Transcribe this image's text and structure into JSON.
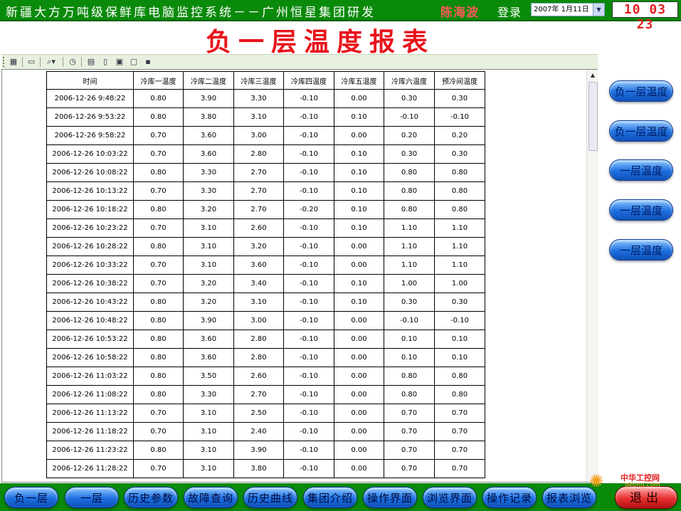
{
  "header": {
    "app_title": "新疆大方万吨级保鲜库电脑监控系统－－广州恒星集团研发",
    "user_name": "陈海波",
    "login_label": "登录",
    "date_value": "2007年 1月11日",
    "clock": "10 03 23"
  },
  "report": {
    "heading": "负一层温度报表",
    "columns": [
      "时间",
      "冷库一温度",
      "冷库二温度",
      "冷库三温度",
      "冷库四温度",
      "冷库五温度",
      "冷库六温度",
      "预冷间温度"
    ],
    "rows": [
      [
        "2006-12-26 9:48:22",
        "0.80",
        "3.90",
        "3.30",
        "-0.10",
        "0.00",
        "0.30",
        "0.30"
      ],
      [
        "2006-12-26 9:53:22",
        "0.80",
        "3.80",
        "3.10",
        "-0.10",
        "0.10",
        "-0.10",
        "-0.10"
      ],
      [
        "2006-12-26 9:58:22",
        "0.70",
        "3.60",
        "3.00",
        "-0.10",
        "0.00",
        "0.20",
        "0.20"
      ],
      [
        "2006-12-26 10:03:22",
        "0.70",
        "3.60",
        "2.80",
        "-0.10",
        "0.10",
        "0.30",
        "0.30"
      ],
      [
        "2006-12-26 10:08:22",
        "0.80",
        "3.30",
        "2.70",
        "-0.10",
        "0.10",
        "0.80",
        "0.80"
      ],
      [
        "2006-12-26 10:13:22",
        "0.70",
        "3.30",
        "2.70",
        "-0.10",
        "0.10",
        "0.80",
        "0.80"
      ],
      [
        "2006-12-26 10:18:22",
        "0.80",
        "3.20",
        "2.70",
        "-0.20",
        "0.10",
        "0.80",
        "0.80"
      ],
      [
        "2006-12-26 10:23:22",
        "0.70",
        "3.10",
        "2.60",
        "-0.10",
        "0.10",
        "1.10",
        "1.10"
      ],
      [
        "2006-12-26 10:28:22",
        "0.80",
        "3.10",
        "3.20",
        "-0.10",
        "0.00",
        "1.10",
        "1.10"
      ],
      [
        "2006-12-26 10:33:22",
        "0.70",
        "3.10",
        "3.60",
        "-0.10",
        "0.00",
        "1.10",
        "1.10"
      ],
      [
        "2006-12-26 10:38:22",
        "0.70",
        "3.20",
        "3.40",
        "-0.10",
        "0.10",
        "1.00",
        "1.00"
      ],
      [
        "2006-12-26 10:43:22",
        "0.80",
        "3.20",
        "3.10",
        "-0.10",
        "0.10",
        "0.30",
        "0.30"
      ],
      [
        "2006-12-26 10:48:22",
        "0.80",
        "3.90",
        "3.00",
        "-0.10",
        "0.00",
        "-0.10",
        "-0.10"
      ],
      [
        "2006-12-26 10:53:22",
        "0.80",
        "3.60",
        "2.80",
        "-0.10",
        "0.00",
        "0.10",
        "0.10"
      ],
      [
        "2006-12-26 10:58:22",
        "0.80",
        "3.60",
        "2.80",
        "-0.10",
        "0.00",
        "0.10",
        "0.10"
      ],
      [
        "2006-12-26 11:03:22",
        "0.80",
        "3.50",
        "2.60",
        "-0.10",
        "0.00",
        "0.80",
        "0.80"
      ],
      [
        "2006-12-26 11:08:22",
        "0.80",
        "3.30",
        "2.70",
        "-0.10",
        "0.00",
        "0.80",
        "0.80"
      ],
      [
        "2006-12-26 11:13:22",
        "0.70",
        "3.10",
        "2.50",
        "-0.10",
        "0.00",
        "0.70",
        "0.70"
      ],
      [
        "2006-12-26 11:18:22",
        "0.70",
        "3.10",
        "2.40",
        "-0.10",
        "0.00",
        "0.70",
        "0.70"
      ],
      [
        "2006-12-26 11:23:22",
        "0.80",
        "3.10",
        "3.90",
        "-0.10",
        "0.00",
        "0.70",
        "0.70"
      ],
      [
        "2006-12-26 11:28:22",
        "0.70",
        "3.10",
        "3.80",
        "-0.10",
        "0.00",
        "0.70",
        "0.70"
      ]
    ]
  },
  "toolbar": {
    "icons": [
      "grid-view-icon",
      "open-folder-icon",
      "zoom-icon",
      "refresh-icon",
      "export-icon",
      "preview-icon",
      "print-icon",
      "page-setup-icon",
      "save-icon"
    ]
  },
  "side_buttons": [
    "负一层温度",
    "负一层温度",
    "一层温度",
    "一层温度",
    "一层温度"
  ],
  "nav_buttons": [
    "负一层",
    "一层",
    "历史参数",
    "故障查询",
    "历史曲线",
    "集团介绍",
    "操作界面",
    "浏览界面",
    "操作记录",
    "报表浏览"
  ],
  "exit_label": "退出",
  "watermark": {
    "text": "中华工控网",
    "url": "gkong.com"
  },
  "colors": {
    "title_bar": "#0a8a0a",
    "heading_red": "#e8141c",
    "button_blue": "#1d6fe0",
    "exit_red": "#e83030"
  }
}
